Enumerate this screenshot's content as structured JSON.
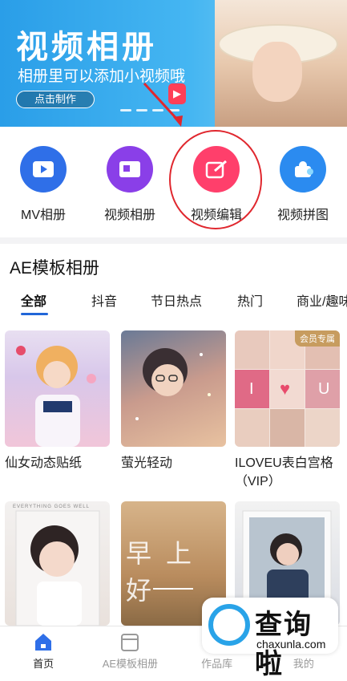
{
  "banner": {
    "title": "视频相册",
    "subtitle": "相册里可以添加小视频哦",
    "button": "点击制作"
  },
  "features": [
    {
      "label": "MV相册",
      "icon": "mv-album-icon",
      "color": "#2f6fe8"
    },
    {
      "label": "视频相册",
      "icon": "video-album-icon",
      "color": "#8a3fe8"
    },
    {
      "label": "视频编辑",
      "icon": "video-edit-icon",
      "color": "#ff3f6b"
    },
    {
      "label": "视频拼图",
      "icon": "video-puzzle-icon",
      "color": "#2b8bf0"
    }
  ],
  "section": {
    "title": "AE模板相册"
  },
  "tabs": [
    "全部",
    "抖音",
    "节日热点",
    "热门",
    "商业/趣味"
  ],
  "cards": [
    {
      "label": "仙女动态贴纸"
    },
    {
      "label": "萤光轻动"
    },
    {
      "label": "ILOVEU表白宫格（VIP）",
      "badge": "会员专属",
      "tiles": [
        "I",
        "♥",
        "U"
      ]
    },
    {
      "label": "",
      "overlay": "EVERYTHING GOES WELL"
    },
    {
      "label": "",
      "overlay": "早上好"
    },
    {
      "label": ""
    }
  ],
  "nav": [
    {
      "label": "首页",
      "active": true
    },
    {
      "label": "AE模板相册",
      "active": false
    },
    {
      "label": "作品库",
      "active": false
    },
    {
      "label": "我的",
      "active": false
    }
  ],
  "watermark": {
    "text": "查询啦",
    "sub": "chaxunla.com"
  }
}
